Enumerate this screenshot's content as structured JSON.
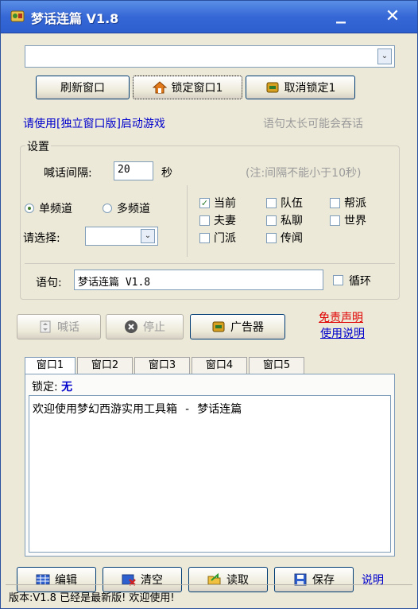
{
  "title": "梦话连篇 V1.8",
  "window_selector": {
    "value": ""
  },
  "buttons": {
    "refresh": "刷新窗口",
    "lock": "锁定窗口1",
    "unlock": "取消锁定1",
    "shout": "喊话",
    "stop": "停止",
    "advertiser": "广告器",
    "edit": "编辑",
    "clear": "清空",
    "read": "读取",
    "save": "保存"
  },
  "hints": {
    "use_standalone": "请使用[独立窗口版]启动游戏",
    "long_sentence": "语句太长可能会吞话"
  },
  "settings": {
    "group_label": "设置",
    "interval_label": "喊话间隔:",
    "interval_value": "20",
    "interval_unit": "秒",
    "interval_note": "(注:间隔不能小于10秒)",
    "single_channel": "单频道",
    "multi_channel": "多频道",
    "select_label": "请选择:",
    "select_value": "",
    "channels": {
      "current": "当前",
      "team": "队伍",
      "guild": "帮派",
      "spouse": "夫妻",
      "private": "私聊",
      "world": "世界",
      "sect": "门派",
      "rumor": "传闻"
    },
    "sentence_label": "语句:",
    "sentence_value": "梦话连篇 V1.8",
    "loop_label": "循环"
  },
  "links": {
    "disclaimer": "免责声明",
    "instructions": "使用说明",
    "help": "说明"
  },
  "tabs": [
    "窗口1",
    "窗口2",
    "窗口3",
    "窗口4",
    "窗口5"
  ],
  "panel": {
    "lock_label": "锁定:",
    "lock_value": "无",
    "message": "欢迎使用梦幻西游实用工具箱 - 梦话连篇"
  },
  "status": "版本:V1.8 已经是最新版! 欢迎使用!",
  "colors": {
    "titlebar": "#3667d6",
    "link": "#0000cc",
    "disabled_text": "#9b9b9b",
    "window_bg": "#ece9d8"
  }
}
